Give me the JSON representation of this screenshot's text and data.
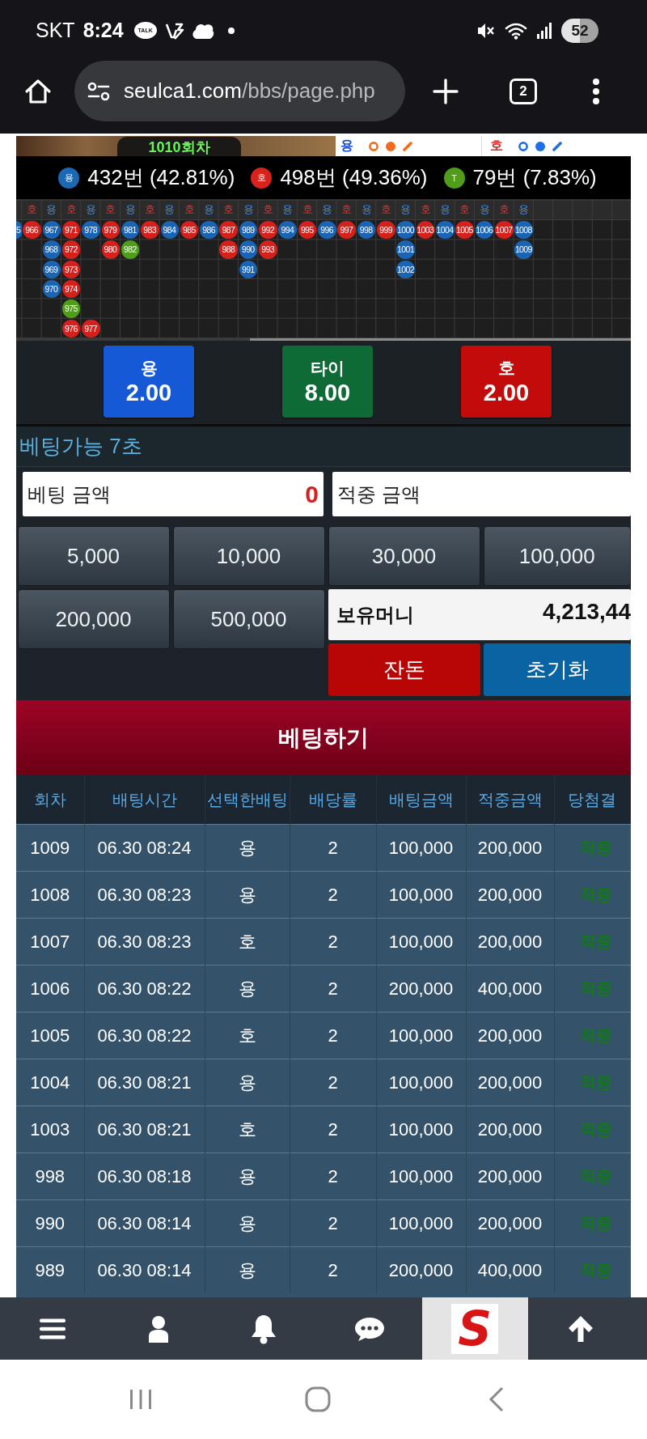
{
  "status_bar": {
    "carrier": "SKT",
    "time": "8:24",
    "talk_badge": "TALK",
    "battery": "52"
  },
  "browser_bar": {
    "url_host": "seulca1.com",
    "url_path": "/bbs/page.php",
    "tab_count": "2"
  },
  "game_header": {
    "round": "1010회차",
    "legend": [
      {
        "kind": "dragon",
        "label": "용",
        "color": "#f26b1d"
      },
      {
        "kind": "tiger",
        "label": "호",
        "color": "#1f6fe5"
      }
    ]
  },
  "stats": [
    {
      "badge": "용",
      "text": "432번 (42.81%)",
      "color": "#1b68b5"
    },
    {
      "badge": "호",
      "text": "498번 (49.36%)",
      "color": "#d8231d"
    },
    {
      "badge": "T",
      "text": "79번 (7.83%)",
      "color": "#4f9d18"
    }
  ],
  "bead_road": {
    "columns": [
      {
        "kind": "partial",
        "cells": [
          {
            "number": "5",
            "color": "#1a64b6"
          }
        ]
      },
      {
        "kind": "tiger",
        "label": "호",
        "cells": [
          {
            "number": "966",
            "color": "#d6201c"
          }
        ]
      },
      {
        "kind": "dragon",
        "label": "용",
        "cells": [
          {
            "number": "967",
            "color": "#1a64b6"
          },
          {
            "number": "968",
            "color": "#1a64b6"
          },
          {
            "number": "969",
            "color": "#1a64b6"
          },
          {
            "number": "970",
            "color": "#1a64b6"
          }
        ]
      },
      {
        "kind": "tiger",
        "label": "호",
        "cells": [
          {
            "number": "971",
            "color": "#d6201c"
          },
          {
            "number": "972",
            "color": "#d6201c"
          },
          {
            "number": "973",
            "color": "#d6201c"
          },
          {
            "number": "974",
            "color": "#d6201c"
          },
          {
            "number": "975",
            "color": "#4f9e19"
          },
          {
            "number": "976",
            "color": "#d6201c"
          }
        ]
      },
      {
        "kind": "dragon",
        "label": "용",
        "cells": [
          {
            "number": "978",
            "color": "#1a64b6"
          },
          null,
          null,
          null,
          null,
          {
            "number": "977",
            "color": "#d6201c"
          }
        ]
      },
      {
        "kind": "tiger",
        "label": "호",
        "cells": [
          {
            "number": "979",
            "color": "#d6201c"
          },
          {
            "number": "980",
            "color": "#d6201c"
          }
        ]
      },
      {
        "kind": "dragon",
        "label": "용",
        "cells": [
          {
            "number": "981",
            "color": "#1a64b6"
          },
          {
            "number": "982",
            "color": "#4f9e19"
          }
        ]
      },
      {
        "kind": "tiger",
        "label": "호",
        "cells": [
          {
            "number": "983",
            "color": "#d6201c"
          }
        ]
      },
      {
        "kind": "dragon",
        "label": "용",
        "cells": [
          {
            "number": "984",
            "color": "#1a64b6"
          }
        ]
      },
      {
        "kind": "tiger",
        "label": "호",
        "cells": [
          {
            "number": "985",
            "color": "#d6201c"
          }
        ]
      },
      {
        "kind": "dragon",
        "label": "용",
        "cells": [
          {
            "number": "986",
            "color": "#1a64b6"
          }
        ]
      },
      {
        "kind": "tiger",
        "label": "호",
        "cells": [
          {
            "number": "987",
            "color": "#d6201c"
          },
          {
            "number": "988",
            "color": "#d6201c"
          }
        ]
      },
      {
        "kind": "dragon",
        "label": "용",
        "cells": [
          {
            "number": "989",
            "color": "#1a64b6"
          },
          {
            "number": "990",
            "color": "#1a64b6"
          },
          {
            "number": "991",
            "color": "#1a64b6"
          }
        ]
      },
      {
        "kind": "tiger",
        "label": "호",
        "cells": [
          {
            "number": "992",
            "color": "#d6201c"
          },
          {
            "number": "993",
            "color": "#d6201c"
          }
        ]
      },
      {
        "kind": "dragon",
        "label": "용",
        "cells": [
          {
            "number": "994",
            "color": "#1a64b6"
          }
        ]
      },
      {
        "kind": "tiger",
        "label": "호",
        "cells": [
          {
            "number": "995",
            "color": "#d6201c"
          }
        ]
      },
      {
        "kind": "dragon",
        "label": "용",
        "cells": [
          {
            "number": "996",
            "color": "#1a64b6"
          }
        ]
      },
      {
        "kind": "tiger",
        "label": "호",
        "cells": [
          {
            "number": "997",
            "color": "#d6201c"
          }
        ]
      },
      {
        "kind": "dragon",
        "label": "용",
        "cells": [
          {
            "number": "998",
            "color": "#1a64b6"
          }
        ]
      },
      {
        "kind": "tiger",
        "label": "호",
        "cells": [
          {
            "number": "999",
            "color": "#d6201c"
          }
        ]
      },
      {
        "kind": "dragon",
        "label": "용",
        "cells": [
          {
            "number": "1000",
            "color": "#1a64b6"
          },
          {
            "number": "1001",
            "color": "#1a64b6"
          },
          {
            "number": "1002",
            "color": "#1a64b6"
          }
        ]
      },
      {
        "kind": "tiger",
        "label": "호",
        "cells": [
          {
            "number": "1003",
            "color": "#d6201c"
          }
        ]
      },
      {
        "kind": "dragon",
        "label": "용",
        "cells": [
          {
            "number": "1004",
            "color": "#1a64b6"
          }
        ]
      },
      {
        "kind": "tiger",
        "label": "호",
        "cells": [
          {
            "number": "1005",
            "color": "#d6201c"
          }
        ]
      },
      {
        "kind": "dragon",
        "label": "용",
        "cells": [
          {
            "number": "1006",
            "color": "#1a64b6"
          }
        ]
      },
      {
        "kind": "tiger",
        "label": "호",
        "cells": [
          {
            "number": "1007",
            "color": "#d6201c"
          }
        ]
      },
      {
        "kind": "dragon",
        "label": "용",
        "cells": [
          {
            "number": "1008",
            "color": "#1a64b6"
          },
          {
            "number": "1009",
            "color": "#1a64b6"
          }
        ]
      }
    ]
  },
  "bet_options": [
    {
      "label": "용",
      "odds": "2.00",
      "color": "#1559d6"
    },
    {
      "label": "타이",
      "odds": "8.00",
      "color": "#0f6b36"
    },
    {
      "label": "호",
      "odds": "2.00",
      "color": "#c40b0b"
    }
  ],
  "bet_panel": {
    "timer": "베팅가능 7초",
    "amounts": [
      {
        "label": "베팅 금액",
        "value": "0"
      },
      {
        "label": "적중 금액"
      }
    ],
    "chips": [
      "5,000",
      "10,000",
      "30,000",
      "100,000",
      "200,000",
      "500,000"
    ],
    "balance": {
      "label": "보유머니",
      "value": "4,213,44"
    },
    "actions": [
      {
        "label": "잔돈",
        "color": "#b80505"
      },
      {
        "label": "초기화",
        "color": "#0a64a4"
      }
    ],
    "submit": "베팅하기"
  },
  "bet_history": {
    "columns": [
      "회차",
      "배팅시간",
      "선택한배팅",
      "배당률",
      "배팅금액",
      "적중금액",
      "당첨결"
    ],
    "rows": [
      [
        "1009",
        "06.30 08:24",
        "용",
        "2",
        "100,000",
        "200,000",
        "적중"
      ],
      [
        "1008",
        "06.30 08:23",
        "용",
        "2",
        "100,000",
        "200,000",
        "적중"
      ],
      [
        "1007",
        "06.30 08:23",
        "호",
        "2",
        "100,000",
        "200,000",
        "적중"
      ],
      [
        "1006",
        "06.30 08:22",
        "용",
        "2",
        "200,000",
        "400,000",
        "적중"
      ],
      [
        "1005",
        "06.30 08:22",
        "호",
        "2",
        "100,000",
        "200,000",
        "적중"
      ],
      [
        "1004",
        "06.30 08:21",
        "용",
        "2",
        "100,000",
        "200,000",
        "적중"
      ],
      [
        "1003",
        "06.30 08:21",
        "호",
        "2",
        "100,000",
        "200,000",
        "적중"
      ],
      [
        "998",
        "06.30 08:18",
        "용",
        "2",
        "100,000",
        "200,000",
        "적중"
      ],
      [
        "990",
        "06.30 08:14",
        "용",
        "2",
        "100,000",
        "200,000",
        "적중"
      ],
      [
        "989",
        "06.30 08:14",
        "용",
        "2",
        "200,000",
        "400,000",
        "적중"
      ]
    ]
  },
  "bottom_nav": {
    "logo": "S"
  }
}
